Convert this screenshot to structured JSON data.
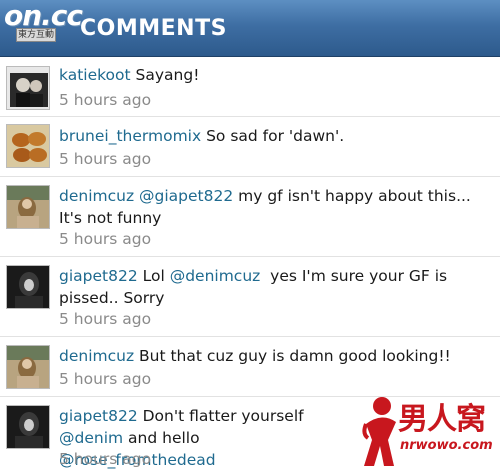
{
  "header": {
    "logo_text": "on.cc",
    "logo_sub": "東方互動",
    "title": "COMMENTS"
  },
  "comments": [
    {
      "user": "katiekoot",
      "parts": [
        {
          "t": " Sayang!"
        }
      ],
      "time": "5 hours ago"
    },
    {
      "user": "brunei_thermomix",
      "parts": [
        {
          "t": " So sad for 'dawn'."
        }
      ],
      "time": "5 hours ago"
    },
    {
      "user": "denimcuz",
      "parts": [
        {
          "t": " "
        },
        {
          "m": "@giapet822"
        },
        {
          "t": " my gf isn't happy about this... It's not funny"
        }
      ],
      "time": "5 hours ago"
    },
    {
      "user": "giapet822",
      "parts": [
        {
          "t": " Lol "
        },
        {
          "m": "@denimcuz"
        },
        {
          "t": "  yes I'm sure your GF is pissed.. Sorry"
        }
      ],
      "time": "5 hours ago"
    },
    {
      "user": "denimcuz",
      "parts": [
        {
          "t": " But that cuz guy is damn good looking!!"
        }
      ],
      "time": "5 hours ago"
    },
    {
      "user": "giapet822",
      "parts": [
        {
          "t": " Don't flatter yourself "
        },
        {
          "m": "@denim"
        },
        {
          "t": "  and hello "
        },
        {
          "m": "@rose_fromthedead"
        }
      ],
      "time": "5 hours ago"
    }
  ],
  "watermark": {
    "main": "男人窝",
    "sub": "nrwowo.com"
  },
  "colors": {
    "header": "#3e6ea3",
    "username": "#1f6a8f",
    "timestamp": "#8a8a8a",
    "watermark": "#c8171e"
  }
}
